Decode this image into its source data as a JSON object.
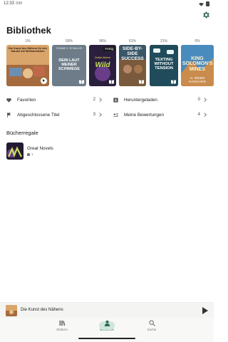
{
  "status": {
    "time": "12:33",
    "indicator": "SIM"
  },
  "header": {
    "title": "Bibliothek"
  },
  "books": [
    {
      "progress": "1%",
      "title": "Die Kunst des Nähens für den Handel mit Weltnachteilen",
      "author": "",
      "badge": "",
      "state": "audio",
      "bg": "#a36a3f"
    },
    {
      "progress": "59%",
      "title": "DEIN LAUT MEINER SCHWIEGE",
      "author": "CONNIE S. ST.MILLER",
      "badge": "",
      "state": "book",
      "bg": "#6d7c88"
    },
    {
      "progress": "96%",
      "title": "Wild",
      "author": "Dalila Marsh",
      "badge": "Fertig",
      "state": "book",
      "bg": "#2a1f3d"
    },
    {
      "progress": "61%",
      "title": "SIDE-BY-SIDE SUCCESS",
      "author": "",
      "badge": "",
      "state": "book",
      "bg": "#2e4656"
    },
    {
      "progress": "21%",
      "title": "TEXTING WITHOUT TENSION",
      "author": "",
      "badge": "",
      "state": "book",
      "bg": "#1f4b5a"
    },
    {
      "progress": "0%",
      "title": "KING SOLOMON'S MINES",
      "author": "H. RIDER HAGGARD",
      "badge": "",
      "state": "book",
      "bg": "#3e78a8"
    }
  ],
  "quick": [
    {
      "icon": "heart-icon",
      "label": "Favoriten",
      "count": "2"
    },
    {
      "icon": "download-icon",
      "label": "Heruntergeladen",
      "count": "0"
    },
    {
      "icon": "flag-icon",
      "label": "Abgeschlossene Titel",
      "count": "3"
    },
    {
      "icon": "star-list-icon",
      "label": "Meine Bewertungen",
      "count": "4"
    }
  ],
  "shelves": {
    "title": "Bücherregale",
    "items": [
      {
        "name": "Great Novels",
        "count": "1"
      }
    ]
  },
  "player": {
    "title": "Die Kunst des Nähens"
  },
  "nav": [
    {
      "label": "Stöbern",
      "icon": "browse-icon",
      "active": false
    },
    {
      "label": "Bibliothek",
      "icon": "person-icon",
      "active": true
    },
    {
      "label": "Suche",
      "icon": "search-icon",
      "active": false
    }
  ],
  "colors": {
    "accent": "#2e6b57",
    "accent_light": "#cfe6dd"
  }
}
